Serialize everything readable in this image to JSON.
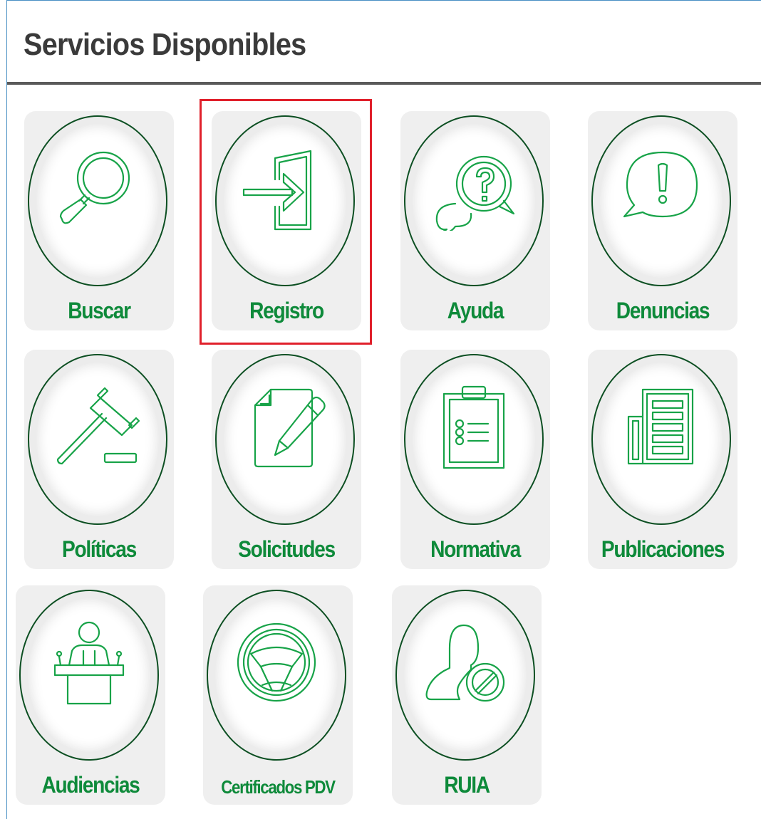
{
  "page": {
    "title": "Servicios Disponibles"
  },
  "services": [
    {
      "label": "Buscar",
      "icon": "magnifier-icon"
    },
    {
      "label": "Registro",
      "icon": "sign-in-icon",
      "highlighted": true
    },
    {
      "label": "Ayuda",
      "icon": "help-chat-icon"
    },
    {
      "label": "Denuncias",
      "icon": "alert-chat-icon"
    },
    {
      "label": "Políticas",
      "icon": "gavel-icon"
    },
    {
      "label": "Solicitudes",
      "icon": "document-pencil-icon"
    },
    {
      "label": "Normativa",
      "icon": "clipboard-list-icon"
    },
    {
      "label": "Publicaciones",
      "icon": "newspaper-icon"
    },
    {
      "label": "Audiencias",
      "icon": "podium-speaker-icon"
    },
    {
      "label": "Certificados PDV",
      "icon": "steering-wheel-icon"
    },
    {
      "label": "RUIA",
      "icon": "user-blocked-icon"
    }
  ],
  "colors": {
    "accent_green": "#0e8a3a",
    "icon_green": "#17a348",
    "highlight_red": "#e0202b",
    "title_gray": "#3a3a3a"
  }
}
